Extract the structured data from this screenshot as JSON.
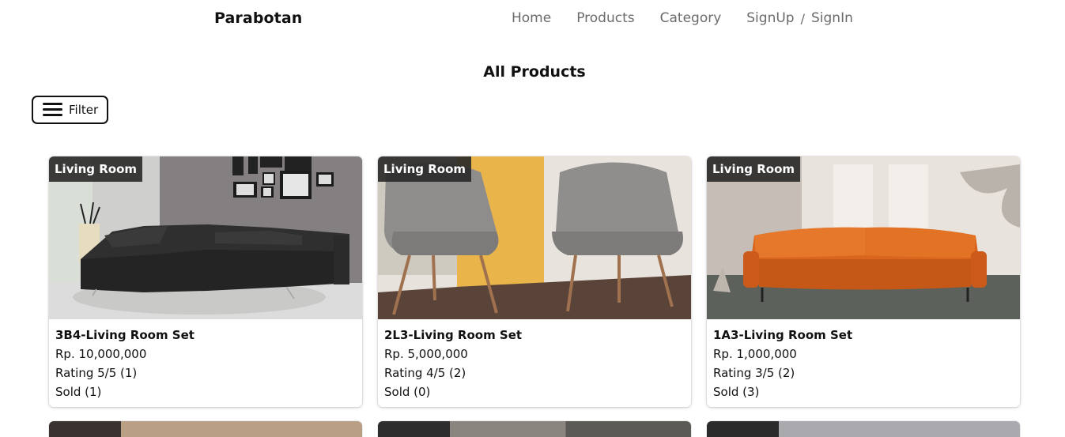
{
  "brand": "Parabotan",
  "nav": {
    "home": "Home",
    "products": "Products",
    "category": "Category",
    "signup": "SignUp",
    "separator": "/",
    "signin": "SignIn"
  },
  "page_title": "All Products",
  "filter": {
    "label": "Filter",
    "icon": "hamburger-menu-icon"
  },
  "products": [
    {
      "category": "Living Room",
      "name": "3B4-Living Room Set",
      "price": "Rp. 10,000,000",
      "rating": "Rating 5/5 (1)",
      "sold": "Sold (1)"
    },
    {
      "category": "Living Room",
      "name": "2L3-Living Room Set",
      "price": "Rp. 5,000,000",
      "rating": "Rating 4/5 (2)",
      "sold": "Sold (0)"
    },
    {
      "category": "Living Room",
      "name": "1A3-Living Room Set",
      "price": "Rp. 1,000,000",
      "rating": "Rating 3/5 (2)",
      "sold": "Sold (3)"
    }
  ]
}
